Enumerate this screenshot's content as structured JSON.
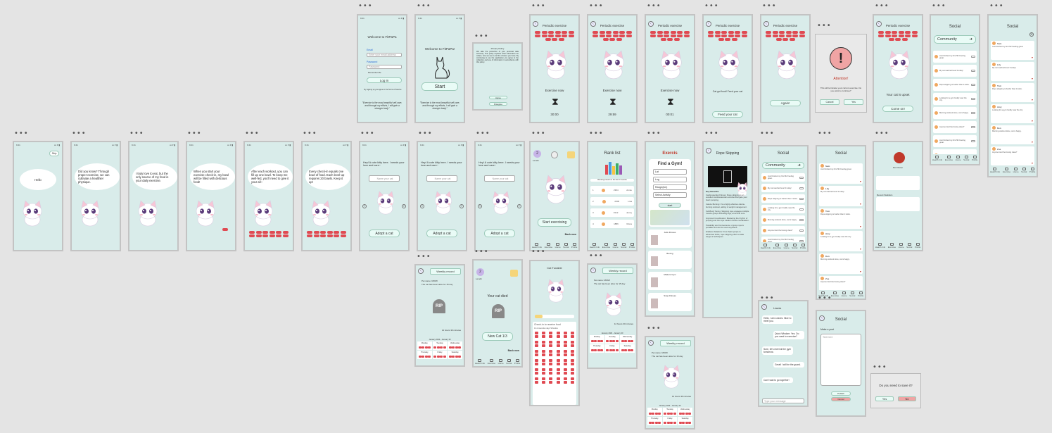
{
  "status": {
    "time": "9:41",
    "signal": "▪▪▪ ▾ ▮"
  },
  "common": {
    "back": "‹",
    "skip": "Skip",
    "adopt": "Adopt a cat",
    "name_placeholder": "Name your cat",
    "feed_prompt": "Feed your cat"
  },
  "onboarding": {
    "greeting": "Hello",
    "tips": [
      "Did you know? Through proper exercise, we can cultivate a healthier physique.",
      "I truly love to eat, but the only source of my food is your daily exercise.",
      "When you start your exercise check-in, my bowl will be filled with delicious food!",
      "After each workout, you can fill up one bowl. To keep me well-fed, you'll need to give it your all~",
      "Every check-in equals one bowl of food. Each level-up requires 20 bowls. Keep it up!"
    ],
    "adopt_intro": "Hey! A cute kitty here. I needs your love and care~"
  },
  "login": {
    "title": "Welcome to FitPaPa",
    "email_label": "Email",
    "email_placeholder": "Enter your email address",
    "password_label": "Password",
    "password_placeholder": "Password",
    "remember": "Remember Me",
    "login_button": "Log in",
    "terms": "By signing up you agree to the Terms of Service",
    "quote": "\"Exercise is the most beautiful self-care, and through my efforts, I will gain a stronger body.\""
  },
  "start": {
    "title": "Welcome to FitPaPa!",
    "button": "Start"
  },
  "privacy": {
    "heading": "Privacy Policy",
    "body": "We take the protection of your personal data seriously. This policy explains what information we collect, how we use it and the choices you have. By continuing to use the application you agree to the collection and use of information in accordance with this policy.",
    "agree": "Agree",
    "disagree": "Disagree"
  },
  "exercise": {
    "title": "Periodic exercise",
    "status": "Exercise now",
    "timers": [
      "30:00",
      "29:59",
      "00:01"
    ],
    "food": "Cat got food! Feed your cat",
    "again": "Again!",
    "upset": "Your cat is upset",
    "come_on": "Come on!"
  },
  "alert": {
    "title": "Attention!",
    "body": "This will terminate your current exercise. Do you want to continue?",
    "cancel": "Cancel",
    "yes": "Yes"
  },
  "save": {
    "question": "Do you need to save it?",
    "yes": "Yes",
    "no": "No"
  },
  "home": {
    "level": "Level1",
    "start_btn": "Start exercising",
    "back_now": "Back now"
  },
  "rank": {
    "title": "Rank list",
    "subtitle": "Ranking based on the last 3 months",
    "names": [
      "Annie",
      "Lisa",
      "Jenny",
      "Mona"
    ],
    "scores": [
      "2364",
      "2000",
      "1912",
      "1886"
    ]
  },
  "gym": {
    "screen_title": "Exercis",
    "title": "Find a Gym!",
    "fields": [
      "Lat",
      "Lng",
      "Range(km)",
      "Select Activity"
    ],
    "start": "start",
    "items": [
      "Jetts Fitness",
      "Boxing",
      "Matters Gym",
      "Snap Fitness"
    ]
  },
  "rope": {
    "title": "Rope Skipping",
    "heading": "Key Benefits:",
    "paragraphs": [
      "Cardiovascular Fitness: Rope skipping is an excellent cardiovascular exercise that gets your heart pumping.",
      "Calorie Burning: It's a highly effective calorie-burning workout, aiding in weight management.",
      "Full-Body Toning: Skipping rope engages multiple muscle groups including legs, arms and core.",
      "Improved Coordination: Mastering the rhythm of jumping and the rope rotation hones coordination.",
      "Portability and Convenience: A jump rope is portable and can be used anywhere.",
      "Endless Variations: From basic jumps to advanced tricks, rope skipping offers a wide range of techniques."
    ]
  },
  "social": {
    "title": "Social",
    "community": "Community",
    "posts": [
      {
        "name": "Sam",
        "text": "Just finished my first 5k! Feeling great."
      },
      {
        "name": "Lily",
        "text": "My cat reached level 3 today!"
      },
      {
        "name": "Tom",
        "text": "Rope skipping is harder than it looks."
      },
      {
        "name": "Amy",
        "text": "Looking for a gym buddy near the city."
      },
      {
        "name": "Ken",
        "text": "Morning workout done, cat is happy."
      },
      {
        "name": "Zoe",
        "text": "Anyone tried the boxing class?"
      }
    ],
    "profile_name": "Pet Owner",
    "recent": "Recent Statistics",
    "chat_user": "Leaves",
    "chat": [
      "Hello, I am Leaves. Nice to meet you.",
      "Quick Wisdom: Yes. Do you want to exercise?",
      "Sure, let's meet at the gym tomorrow.",
      "Great! I will be the guard.",
      "Can't wait to go together!"
    ],
    "chat_input": "Type your message",
    "make_post": "Make a post",
    "post_placeholder": "Text here",
    "publish": "Publish",
    "cancel": "Cancel"
  },
  "record": {
    "title": "Weekly record",
    "pet_name": "Pet name: MOMI",
    "alive": "The cat has been alive for 15 day",
    "timer": "12 hours 30 minutes",
    "month": "January 2024 - January 30",
    "days": [
      "Monday",
      "Tuesday",
      "Wednesday",
      "Thursday",
      "Friday",
      "Saturday"
    ]
  },
  "died": {
    "text": "Your cat died",
    "new_cat": "New Cat 1/3",
    "back_now": "Back now"
  },
  "checkin": {
    "title": "Cat Tunable",
    "heading": "Check-in to receive food",
    "sub": "12 consecutive days Schedule"
  },
  "nav": [
    "Health Info",
    "Exercise",
    "Home",
    "Social",
    "Profile"
  ]
}
